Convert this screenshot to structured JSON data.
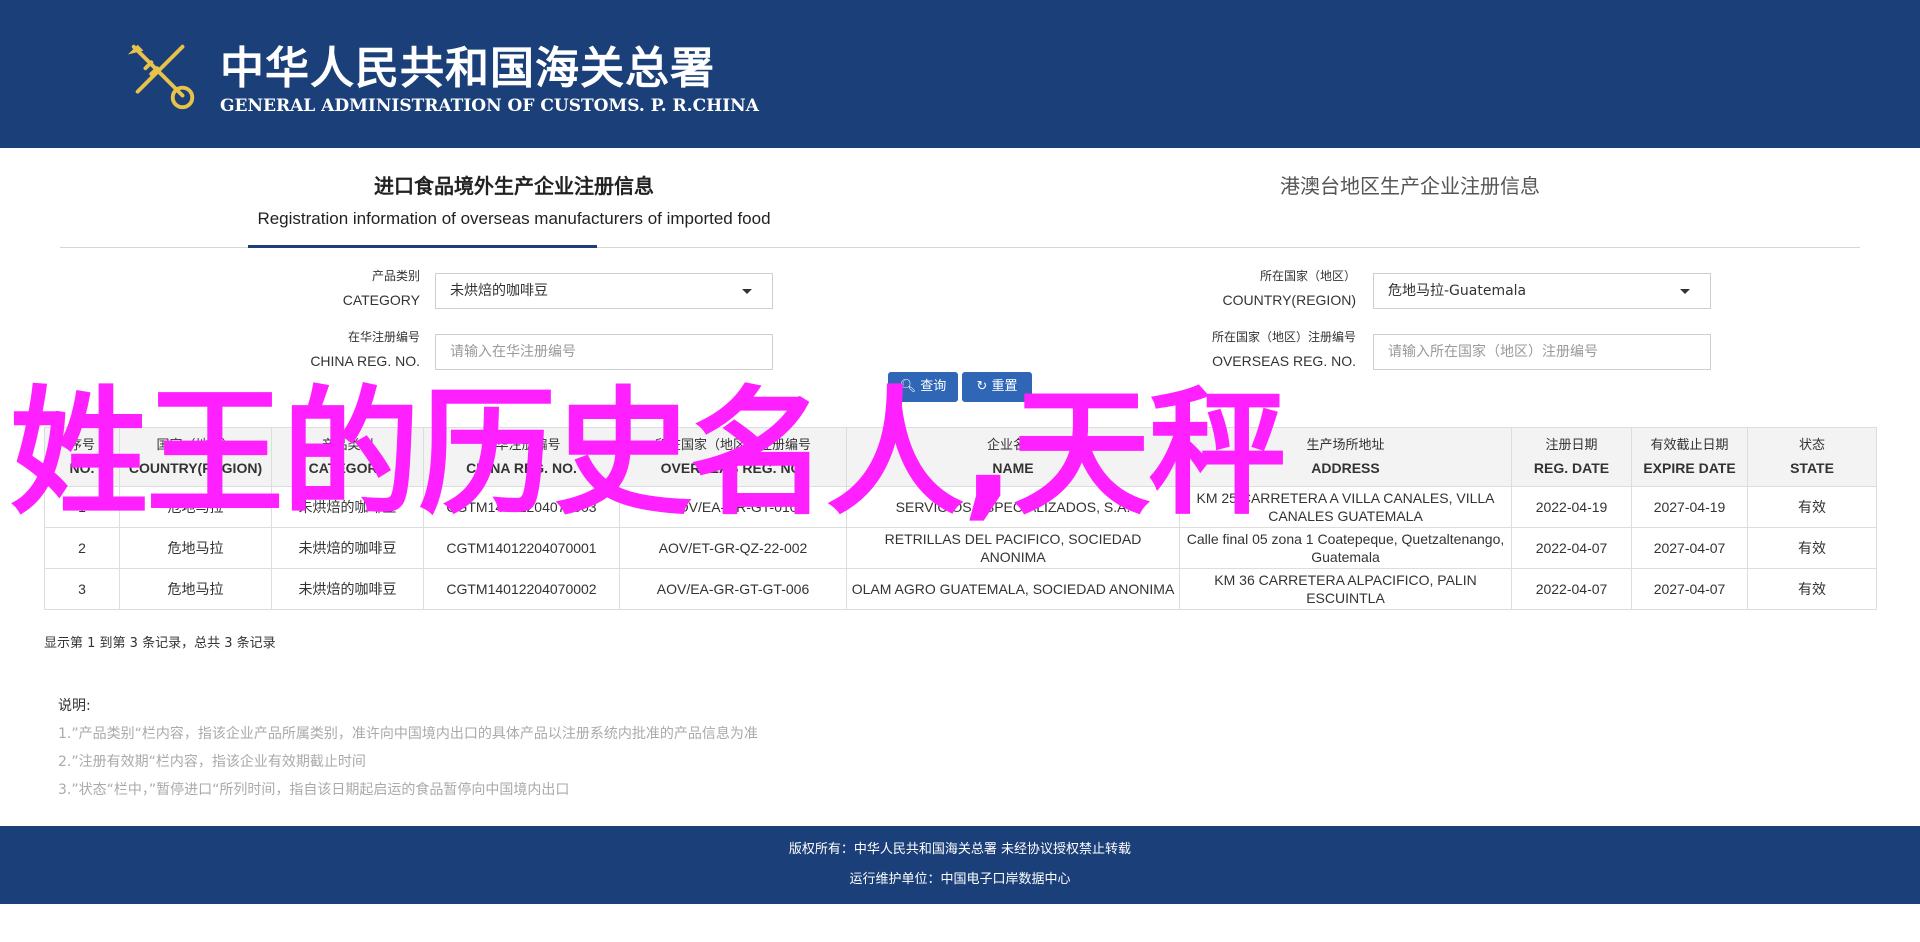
{
  "header": {
    "title_cn": "中华人民共和国海关总署",
    "title_en": "GENERAL ADMINISTRATION OF CUSTOMS. P. R.CHINA",
    "emblem_icon": "customs-key-emblem-icon"
  },
  "tabs": [
    {
      "label_cn": "进口食品境外生产企业注册信息",
      "label_en": "Registration information of overseas manufacturers of imported food"
    },
    {
      "label_cn": "港澳台地区生产企业注册信息"
    }
  ],
  "filters": {
    "category": {
      "label_cn": "产品类别",
      "label_en": "CATEGORY",
      "value": "未烘焙的咖啡豆"
    },
    "country": {
      "label_cn": "所在国家（地区）",
      "label_en": "COUNTRY(REGION)",
      "value": "危地马拉-Guatemala"
    },
    "china_reg": {
      "label_cn": "在华注册编号",
      "label_en": "CHINA REG. NO.",
      "placeholder": "请输入在华注册编号"
    },
    "overseas_reg": {
      "label_cn": "所在国家（地区）注册编号",
      "label_en": "OVERSEAS REG. NO.",
      "placeholder": "请输入所在国家（地区）注册编号"
    }
  },
  "buttons": {
    "search": "查询",
    "reset": "重置"
  },
  "table": {
    "columns": [
      {
        "cn": "序号",
        "en": "NO."
      },
      {
        "cn": "国家（地区）",
        "en": "COUNTRY(REGION)"
      },
      {
        "cn": "产品类别",
        "en": "CATEGORY"
      },
      {
        "cn": "在华注册编号",
        "en": "CHINA REG. NO."
      },
      {
        "cn": "所在国家（地区）注册编号",
        "en": "OVERSEAS REG. NO."
      },
      {
        "cn": "企业名称",
        "en": "NAME"
      },
      {
        "cn": "生产场所地址",
        "en": "ADDRESS"
      },
      {
        "cn": "注册日期",
        "en": "REG. DATE"
      },
      {
        "cn": "有效截止日期",
        "en": "EXPIRE DATE"
      },
      {
        "cn": "状态",
        "en": "STATE"
      }
    ],
    "rows": [
      [
        "1",
        "危地马拉",
        "未烘焙的咖啡豆",
        "CGTM14012204070003",
        "AOV/EA-GR-GT-010",
        "SERVICIOS ESPECIALIZADOS, S.A.",
        "KM 25 CARRETERA A VILLA CANALES, VILLA CANALES GUATEMALA",
        "2022-04-19",
        "2027-04-19",
        "有效"
      ],
      [
        "2",
        "危地马拉",
        "未烘焙的咖啡豆",
        "CGTM14012204070001",
        "AOV/ET-GR-QZ-22-002",
        "RETRILLAS DEL PACIFICO, SOCIEDAD ANONIMA",
        "Calle final 05 zona 1 Coatepeque, Quetzaltenango, Guatemala",
        "2022-04-07",
        "2027-04-07",
        "有效"
      ],
      [
        "3",
        "危地马拉",
        "未烘焙的咖啡豆",
        "CGTM14012204070002",
        "AOV/EA-GR-GT-GT-006",
        "OLAM AGRO GUATEMALA, SOCIEDAD ANONIMA",
        "KM 36 CARRETERA ALPACIFICO, PALIN ESCUINTLA",
        "2022-04-07",
        "2027-04-07",
        "有效"
      ]
    ]
  },
  "overlay_text": "姓王的历史名人,天秤",
  "pager_info": "显示第 1 到第 3 条记录，总共 3 条记录",
  "notes": {
    "title": "说明:",
    "lines": [
      "1.”产品类别“栏内容，指该企业产品所属类别，准许向中国境内出口的具体产品以注册系统内批准的产品信息为准",
      "2.”注册有效期“栏内容，指该企业有效期截止时间",
      "3.”状态“栏中，”暂停进口“所列时间，指自该日期起启运的食品暂停向中国境内出口"
    ]
  },
  "footer": {
    "copyright": "版权所有：中华人民共和国海关总署 未经协议授权禁止转载",
    "maintainer": "运行维护单位：中国电子口岸数据中心"
  }
}
